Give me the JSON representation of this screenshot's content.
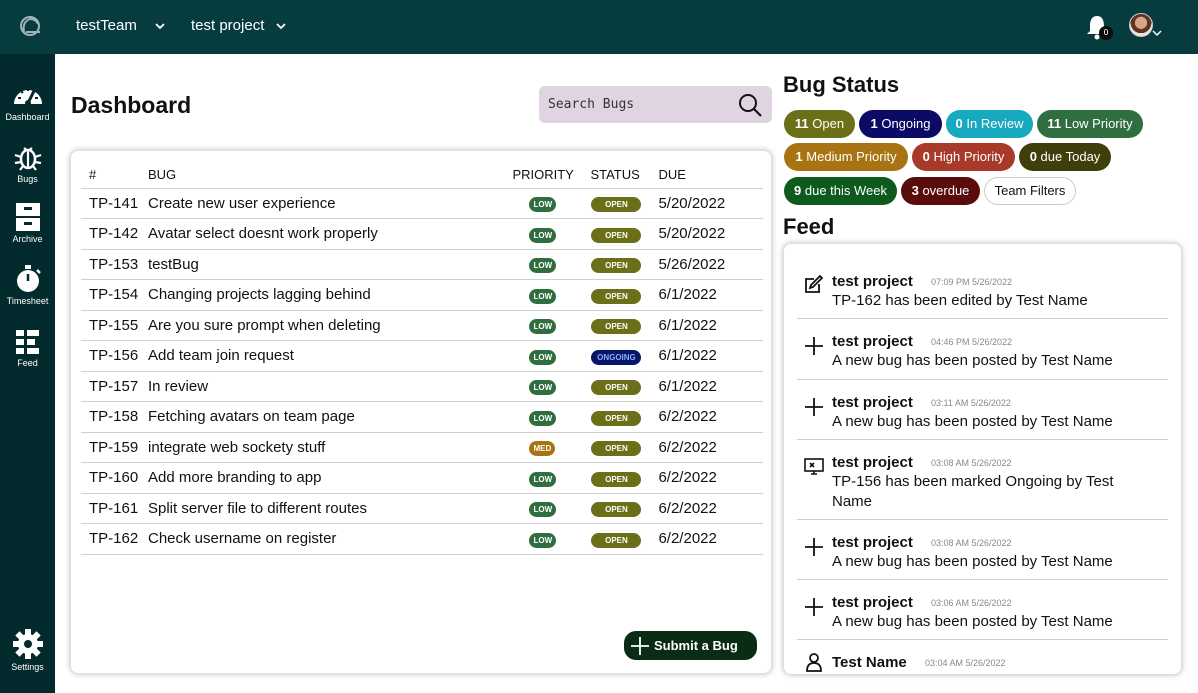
{
  "header": {
    "team": "testTeam",
    "project": "test project",
    "notification_count": "0"
  },
  "sidebar": {
    "items": [
      {
        "label": "Dashboard",
        "icon": "speedometer-icon"
      },
      {
        "label": "Bugs",
        "icon": "bug-icon"
      },
      {
        "label": "Archive",
        "icon": "archive-icon"
      },
      {
        "label": "Timesheet",
        "icon": "stopwatch-icon"
      },
      {
        "label": "Feed",
        "icon": "feed-list-icon"
      },
      {
        "label": "Settings",
        "icon": "gear-icon"
      }
    ]
  },
  "dashboard": {
    "title": "Dashboard",
    "search_placeholder": "Search Bugs",
    "columns": [
      "#",
      "BUG",
      "PRIORITY",
      "STATUS",
      "DUE"
    ],
    "rows": [
      {
        "id": "TP-141",
        "bug": "Create new user experience",
        "priority": "LOW",
        "status": "OPEN",
        "due": "5/20/2022"
      },
      {
        "id": "TP-142",
        "bug": "Avatar select doesnt work properly",
        "priority": "LOW",
        "status": "OPEN",
        "due": "5/20/2022"
      },
      {
        "id": "TP-153",
        "bug": "testBug",
        "priority": "LOW",
        "status": "OPEN",
        "due": "5/26/2022"
      },
      {
        "id": "TP-154",
        "bug": "Changing projects lagging behind",
        "priority": "LOW",
        "status": "OPEN",
        "due": "6/1/2022"
      },
      {
        "id": "TP-155",
        "bug": "Are you sure prompt when deleting",
        "priority": "LOW",
        "status": "OPEN",
        "due": "6/1/2022"
      },
      {
        "id": "TP-156",
        "bug": "Add team join request",
        "priority": "LOW",
        "status": "ONGOING",
        "due": "6/1/2022"
      },
      {
        "id": "TP-157",
        "bug": "In review",
        "priority": "LOW",
        "status": "OPEN",
        "due": "6/1/2022"
      },
      {
        "id": "TP-158",
        "bug": "Fetching avatars on team page",
        "priority": "LOW",
        "status": "OPEN",
        "due": "6/2/2022"
      },
      {
        "id": "TP-159",
        "bug": "integrate web sockety stuff",
        "priority": "MED",
        "status": "OPEN",
        "due": "6/2/2022"
      },
      {
        "id": "TP-160",
        "bug": "Add more branding to app",
        "priority": "LOW",
        "status": "OPEN",
        "due": "6/2/2022"
      },
      {
        "id": "TP-161",
        "bug": "Split server file to different routes",
        "priority": "LOW",
        "status": "OPEN",
        "due": "6/2/2022"
      },
      {
        "id": "TP-162",
        "bug": "Check username on register",
        "priority": "LOW",
        "status": "OPEN",
        "due": "6/2/2022"
      }
    ],
    "submit_label": "Submit a Bug"
  },
  "bug_status": {
    "title": "Bug Status",
    "chips": [
      {
        "count": "11",
        "label": "Open",
        "color": "#6b6f18"
      },
      {
        "count": "1",
        "label": "Ongoing",
        "color": "#0b0b66"
      },
      {
        "count": "0",
        "label": "In Review",
        "color": "#17a9bd"
      },
      {
        "count": "11",
        "label": "Low Priority",
        "color": "#2f6e3f"
      },
      {
        "count": "1",
        "label": "Medium Priority",
        "color": "#a87413"
      },
      {
        "count": "0",
        "label": "High Priority",
        "color": "#a83a2a"
      },
      {
        "count": "0",
        "label": "due Today",
        "color": "#3f3f0c"
      },
      {
        "count": "9",
        "label": "due this Week",
        "color": "#0e5a1c"
      },
      {
        "count": "3",
        "label": "overdue",
        "color": "#5a0c0c"
      }
    ],
    "team_filters_label": "Team Filters"
  },
  "feed": {
    "title": "Feed",
    "items": [
      {
        "icon": "edit-icon",
        "project": "test project",
        "time": "07:09 PM 5/26/2022",
        "message": "TP-162 has been edited by Test Name"
      },
      {
        "icon": "plus-icon",
        "project": "test project",
        "time": "04:46 PM 5/26/2022",
        "message": "A new bug has been posted by Test Name"
      },
      {
        "icon": "plus-icon",
        "project": "test project",
        "time": "03:11 AM 5/26/2022",
        "message": "A new bug has been posted by Test Name"
      },
      {
        "icon": "monitor-status-icon",
        "project": "test project",
        "time": "03:08 AM 5/26/2022",
        "message": "TP-156 has been marked Ongoing by Test Name"
      },
      {
        "icon": "plus-icon",
        "project": "test project",
        "time": "03:08 AM 5/26/2022",
        "message": "A new bug has been posted by Test Name"
      },
      {
        "icon": "plus-icon",
        "project": "test project",
        "time": "03:06 AM 5/26/2022",
        "message": "A new bug has been posted by Test Name"
      },
      {
        "icon": "person-icon",
        "project": "Test Name",
        "time": "03:04 AM 5/26/2022",
        "message": ""
      }
    ]
  }
}
